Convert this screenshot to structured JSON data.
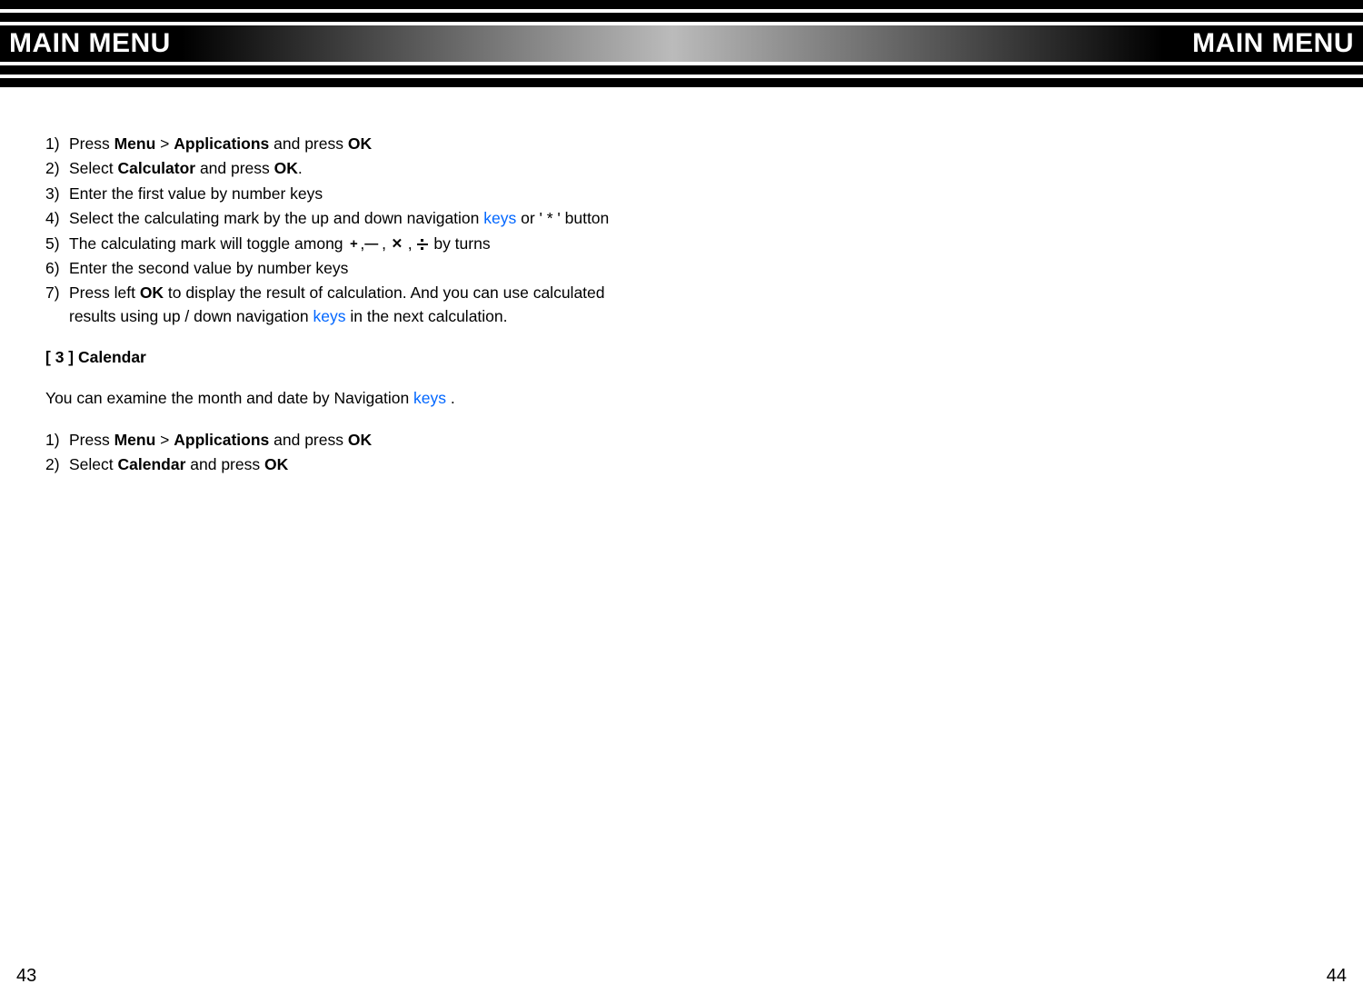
{
  "header": {
    "title_left": "MAIN MENU",
    "title_right": "MAIN MENU"
  },
  "calculator_steps": {
    "s1": {
      "num": "1)",
      "pre": "Press ",
      "menu": "Menu",
      "sep": " > ",
      "app": "Applications",
      "mid": " and press ",
      "ok": "OK"
    },
    "s2": {
      "num": "2)",
      "pre": "Select ",
      "calc": "Calculator",
      "mid": " and press ",
      "ok": "OK",
      "post": "."
    },
    "s3": {
      "num": "3)",
      "text": "Enter the first value by number keys"
    },
    "s4": {
      "num": "4)",
      "pre": "Select the calculating mark by the up and down navigation ",
      "keys": "keys",
      "post": " or ' * ' button"
    },
    "s5": {
      "num": "5)",
      "pre": "The calculating mark will toggle among   ",
      "post": "  by turns"
    },
    "s6": {
      "num": "6)",
      "text": "Enter the second value by number keys"
    },
    "s7": {
      "num": "7)",
      "pre": "Press left ",
      "ok": "OK",
      "mid": "  to display the result of calculation. And you can use calculated",
      "cont": "results using up / down navigation ",
      "keys": "keys",
      "post": " in the next calculation."
    }
  },
  "section3": {
    "heading": "[ 3 ]  Calendar",
    "intro_pre": "You can examine the month and date by Navigation ",
    "intro_keys": "keys",
    "intro_post": "  ."
  },
  "calendar_steps": {
    "s1": {
      "num": "1)",
      "pre": "Press ",
      "menu": "Menu",
      "sep": " > ",
      "app": "Applications",
      "mid": " and press ",
      "ok": "OK"
    },
    "s2": {
      "num": "2)",
      "pre": "Select ",
      "cal": "Calendar",
      "mid": " and press ",
      "ok": "OK"
    }
  },
  "operators": {
    "plus": "+",
    "comma1": ",",
    "minus": "—",
    "comma2": " , ",
    "times": "✕",
    "comma3": " , "
  },
  "footer": {
    "left_page": "43",
    "right_page": "44"
  }
}
